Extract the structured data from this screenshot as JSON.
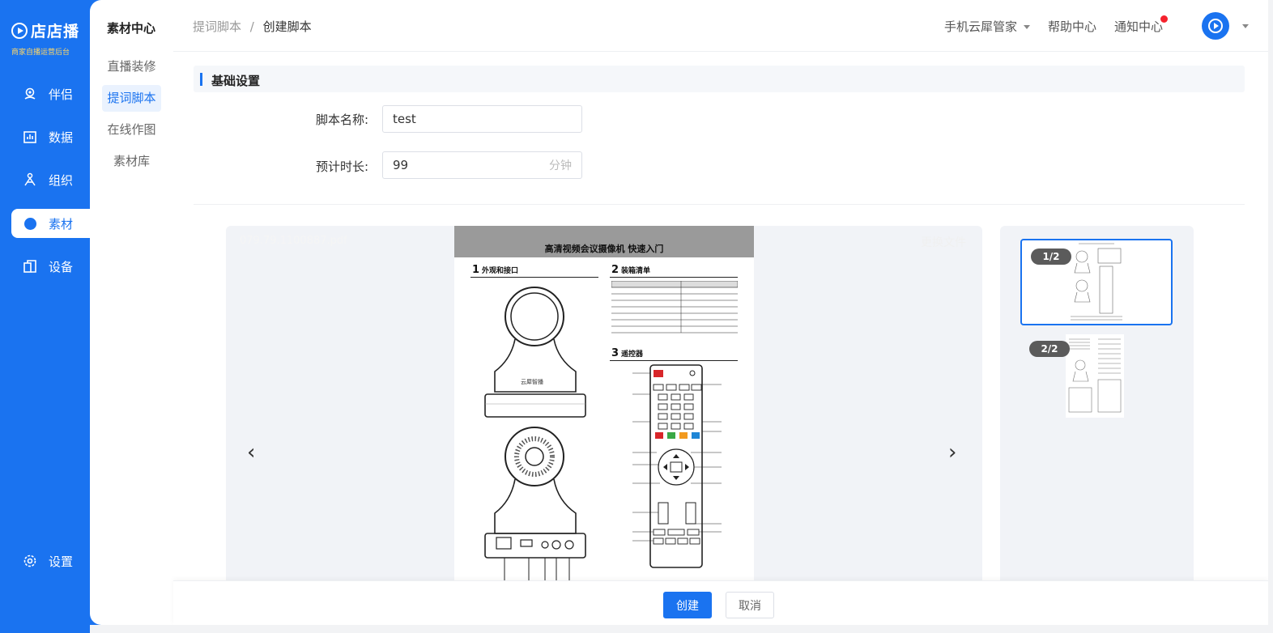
{
  "app": {
    "logo_title": "店店播",
    "logo_sub": "商家自播运营后台"
  },
  "rail": {
    "items": [
      {
        "label": "伴侣",
        "icon": "companion-icon"
      },
      {
        "label": "数据",
        "icon": "chart-icon"
      },
      {
        "label": "组织",
        "icon": "org-icon"
      },
      {
        "label": "素材",
        "icon": "material-icon",
        "active": true
      },
      {
        "label": "设备",
        "icon": "device-icon"
      }
    ],
    "settings_label": "设置"
  },
  "submenu": {
    "title": "素材中心",
    "items": [
      {
        "label": "直播装修"
      },
      {
        "label": "提词脚本",
        "active": true
      },
      {
        "label": "在线作图"
      },
      {
        "label": "素材库"
      }
    ]
  },
  "header": {
    "breadcrumb_parent": "提词脚本",
    "breadcrumb_sep": "/",
    "breadcrumb_current": "创建脚本",
    "links": {
      "cloud": "手机云犀管家",
      "help": "帮助中心",
      "notice": "通知中心"
    }
  },
  "form": {
    "section_title": "基础设置",
    "name_label": "脚本名称:",
    "name_value": "test",
    "duration_label": "预计时长:",
    "duration_value": "99",
    "duration_suffix": "分钟"
  },
  "preview": {
    "file_name": "079.79.1100887.pdf",
    "change_file": "更换文件",
    "doc_title": "高清视频会议摄像机  快速入门",
    "sec1": "外观和接口",
    "sec2": "装箱清单",
    "sec3": "遥控器",
    "brand": "云犀智播",
    "pages": [
      {
        "label": "1/2",
        "selected": true
      },
      {
        "label": "2/2",
        "selected": false
      }
    ]
  },
  "footer": {
    "create": "创建",
    "cancel": "取消"
  },
  "colors": {
    "primary": "#1a73f0",
    "notice_dot": "#f5222d"
  }
}
